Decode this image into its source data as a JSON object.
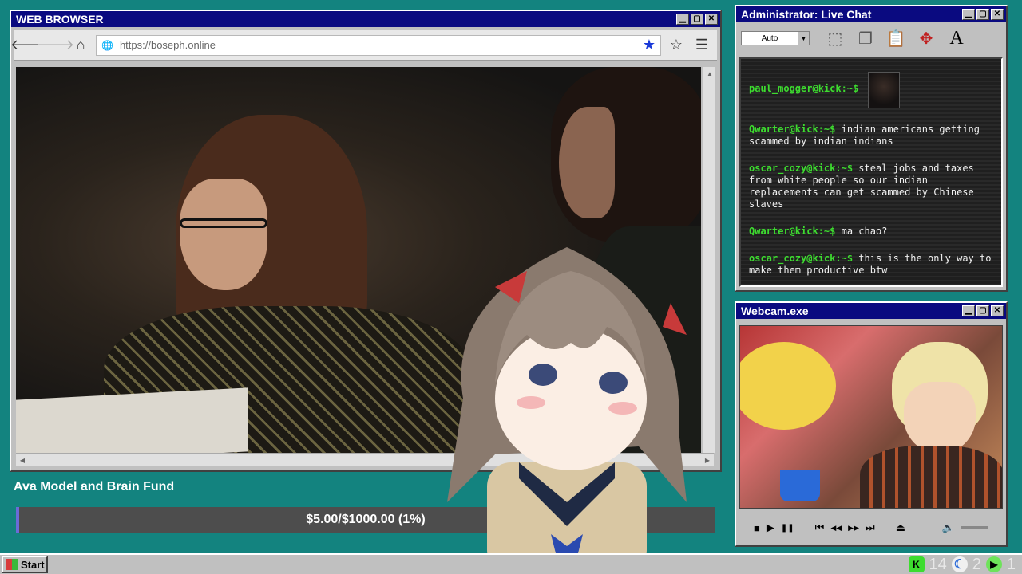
{
  "browser": {
    "title": "WEB BROWSER",
    "url": "https://boseph.online",
    "controls": {
      "minimize": "▁",
      "maximize": "▢",
      "close": "✕"
    },
    "nav": {
      "back": "🡐",
      "forward": "🡒",
      "home": "⌂",
      "globe": "🌐",
      "bookmark_filled": "★",
      "bookmark_empty": "☆",
      "menu": "☰"
    }
  },
  "fund": {
    "title": "Ava Model and Brain Fund",
    "progress_text": "$5.00/$1000.00 (1%)",
    "progress_fraction": 0.005
  },
  "chat": {
    "title": "Administrator: Live Chat",
    "select_value": "Auto",
    "messages": [
      {
        "user": "paul_mogger@kick:~$",
        "text": ""
      },
      {
        "user": "Qwarter@kick:~$",
        "text": "indian americans getting scammed by indian indians"
      },
      {
        "user": "oscar_cozy@kick:~$",
        "text": "steal jobs and taxes from white people so our indian replacements can get scammed by Chinese slaves"
      },
      {
        "user": "Qwarter@kick:~$",
        "text": "ma chao?"
      },
      {
        "user": "oscar_cozy@kick:~$",
        "text": "this is the only way to make them productive btw"
      }
    ]
  },
  "webcam": {
    "title": "Webcam.exe",
    "media": {
      "stop": "■",
      "play": "▶",
      "pause": "❚❚",
      "prev": "⏮",
      "rewind": "◀◀",
      "forward": "▶▶",
      "next": "⏭",
      "eject": "⏏",
      "volume": "🔈"
    }
  },
  "taskbar": {
    "start_label": "Start",
    "tray": [
      {
        "icon": "kick-icon",
        "glyph": "K",
        "count": "14"
      },
      {
        "icon": "moon-icon",
        "glyph": "☾",
        "count": "2"
      },
      {
        "icon": "play-icon",
        "glyph": "▶",
        "count": "1"
      }
    ]
  },
  "colors": {
    "desktop": "#13837f",
    "titlebar": "#0a0a80",
    "chat_username": "#3ddc2f",
    "fund_fill": "#6b6bd8",
    "star": "#1a3ad8"
  }
}
